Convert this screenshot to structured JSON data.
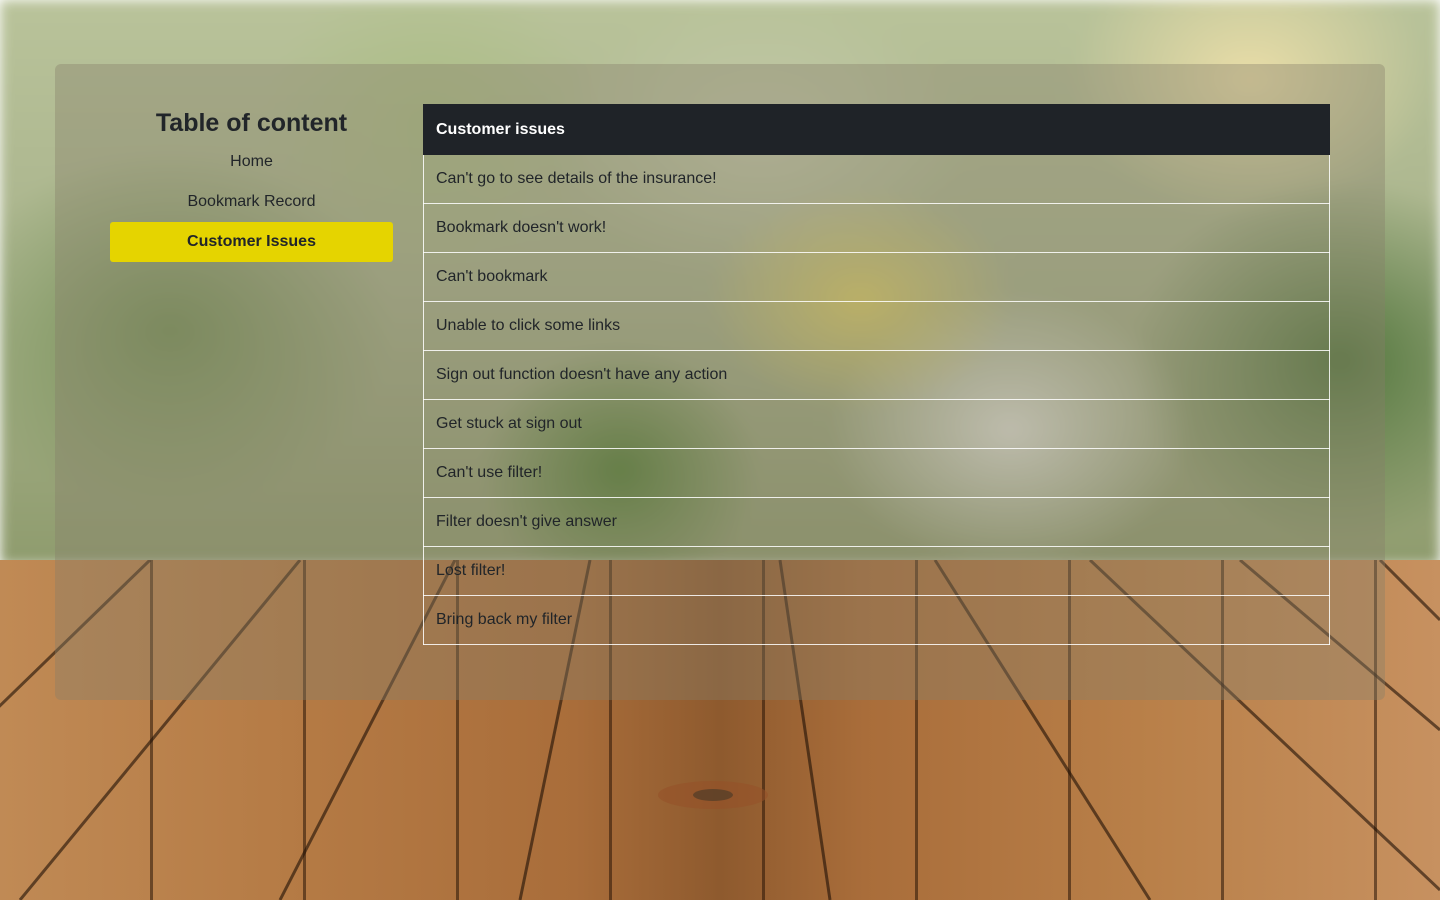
{
  "sidebar": {
    "title": "Table of content",
    "items": [
      {
        "label": "Home"
      },
      {
        "label": "Bookmark Record"
      },
      {
        "label": "Customer Issues"
      }
    ]
  },
  "issues_table": {
    "header": "Customer issues",
    "rows": [
      "Can't go to see details of the insurance!",
      "Bookmark doesn't work!",
      "Can't bookmark",
      "Unable to click some links",
      "Sign out function doesn't have any action",
      "Get stuck at sign out",
      "Can't use filter!",
      "Filter doesn't give answer",
      "Lost filter!",
      "Bring back my filter"
    ]
  },
  "colors": {
    "active_nav": "#e5d400",
    "table_header_bg": "#1f2328"
  }
}
